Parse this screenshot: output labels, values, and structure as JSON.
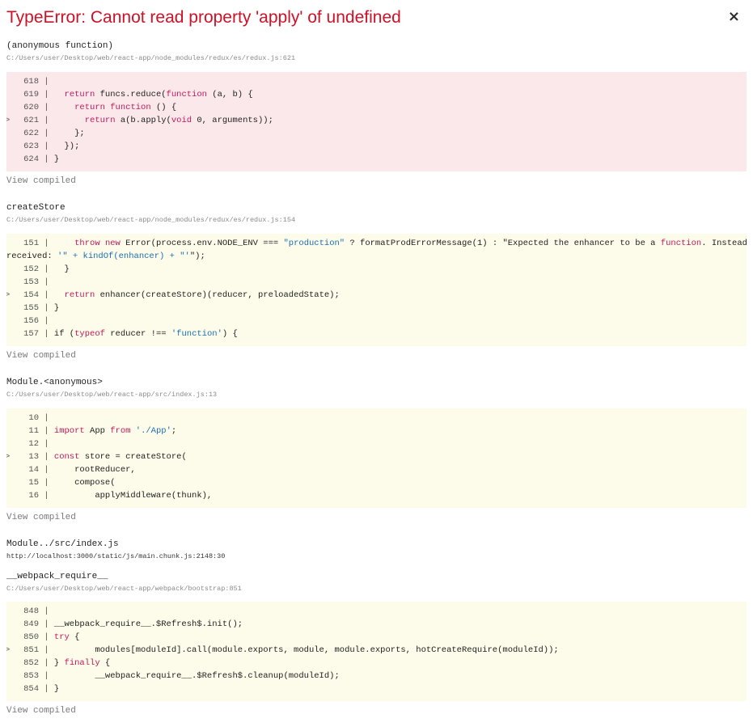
{
  "error": {
    "title": "TypeError: Cannot read property 'apply' of undefined",
    "close": "×"
  },
  "view_compiled": "View compiled",
  "frames": [
    {
      "fn": "(anonymous function)",
      "loc": "C:/Users/user/Desktop/web/react-app/node_modules/redux/es/redux.js:621",
      "lines": [
        {
          "marker": "",
          "num": "618",
          "code": ""
        },
        {
          "marker": "",
          "num": "619",
          "code": "  return funcs.reduce(function (a, b) {"
        },
        {
          "marker": "",
          "num": "620",
          "code": "    return function () {"
        },
        {
          "marker": ">",
          "num": "621",
          "code": "      return a(b.apply(void 0, arguments));"
        },
        {
          "marker": "",
          "num": "622",
          "code": "    };"
        },
        {
          "marker": "",
          "num": "623",
          "code": "  });"
        },
        {
          "marker": "",
          "num": "624",
          "code": "}"
        }
      ]
    },
    {
      "fn": "createStore",
      "loc": "C:/Users/user/Desktop/web/react-app/node_modules/redux/es/redux.js:154",
      "lines": [
        {
          "marker": "",
          "num": "151",
          "code": "    throw new Error(process.env.NODE_ENV === \"production\" ? formatProdErrorMessage(1) : \"Expected the enhancer to be a function. Instead,"
        },
        {
          "marker": "",
          "num": "",
          "code": "received: '\" + kindOf(enhancer) + \"'\");"
        },
        {
          "marker": "",
          "num": "152",
          "code": "  }"
        },
        {
          "marker": "",
          "num": "153",
          "code": ""
        },
        {
          "marker": ">",
          "num": "154",
          "code": "  return enhancer(createStore)(reducer, preloadedState);"
        },
        {
          "marker": "",
          "num": "155",
          "code": "}"
        },
        {
          "marker": "",
          "num": "156",
          "code": ""
        },
        {
          "marker": "",
          "num": "157",
          "code": "if (typeof reducer !== 'function') {"
        }
      ]
    },
    {
      "fn": "Module.<anonymous>",
      "loc": "C:/Users/user/Desktop/web/react-app/src/index.js:13",
      "lines": [
        {
          "marker": "",
          "num": "10",
          "code": ""
        },
        {
          "marker": "",
          "num": "11",
          "code": "import App from './App';"
        },
        {
          "marker": "",
          "num": "12",
          "code": ""
        },
        {
          "marker": ">",
          "num": "13",
          "code": "const store = createStore("
        },
        {
          "marker": "",
          "num": "14",
          "code": "    rootReducer,"
        },
        {
          "marker": "",
          "num": "15",
          "code": "    compose("
        },
        {
          "marker": "",
          "num": "16",
          "code": "        applyMiddleware(thunk),"
        }
      ]
    },
    {
      "fn": "Module../src/index.js",
      "loc": "http://localhost:3000/static/js/main.chunk.js:2148:30"
    },
    {
      "fn": "__webpack_require__",
      "loc": "C:/Users/user/Desktop/web/react-app/webpack/bootstrap:851",
      "lines": [
        {
          "marker": "",
          "num": "848",
          "code": ""
        },
        {
          "marker": "",
          "num": "849",
          "code": "__webpack_require__.$Refresh$.init();"
        },
        {
          "marker": "",
          "num": "850",
          "code": "try {"
        },
        {
          "marker": ">",
          "num": "851",
          "code": "        modules[moduleId].call(module.exports, module, module.exports, hotCreateRequire(moduleId));"
        },
        {
          "marker": "",
          "num": "852",
          "code": "} finally {"
        },
        {
          "marker": "",
          "num": "853",
          "code": "        __webpack_require__.$Refresh$.cleanup(moduleId);"
        },
        {
          "marker": "",
          "num": "854",
          "code": "}"
        }
      ]
    }
  ]
}
